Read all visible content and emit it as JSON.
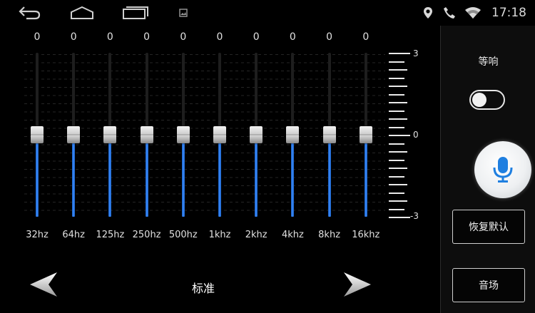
{
  "status_bar": {
    "nav_icons": [
      "back-icon",
      "home-icon",
      "recent-apps-icon",
      "image-notification-icon"
    ],
    "status_icons": [
      "location-icon",
      "phone-icon",
      "wifi-icon"
    ],
    "time": "17:18"
  },
  "equalizer": {
    "bands": [
      {
        "freq": "32hz",
        "value": 0,
        "value_text": "0"
      },
      {
        "freq": "64hz",
        "value": 0,
        "value_text": "0"
      },
      {
        "freq": "125hz",
        "value": 0,
        "value_text": "0"
      },
      {
        "freq": "250hz",
        "value": 0,
        "value_text": "0"
      },
      {
        "freq": "500hz",
        "value": 0,
        "value_text": "0"
      },
      {
        "freq": "1khz",
        "value": 0,
        "value_text": "0"
      },
      {
        "freq": "2khz",
        "value": 0,
        "value_text": "0"
      },
      {
        "freq": "4khz",
        "value": 0,
        "value_text": "0"
      },
      {
        "freq": "8khz",
        "value": 0,
        "value_text": "0"
      },
      {
        "freq": "16khz",
        "value": 0,
        "value_text": "0"
      }
    ],
    "range": [
      -3,
      3
    ],
    "scale": {
      "max_label": "3",
      "mid_label": "0",
      "min_label": "-3"
    },
    "fill_color": "#3b8cff"
  },
  "preset": {
    "name": "标准",
    "prev_icon": "arrow-left-icon",
    "next_icon": "arrow-right-icon"
  },
  "side_panel": {
    "loudness_label": "等响",
    "loudness_on": false,
    "mic_icon": "microphone-icon",
    "mic_color": "#1f7fe0",
    "reset_label": "恢复默认",
    "sound_field_label": "音场"
  }
}
